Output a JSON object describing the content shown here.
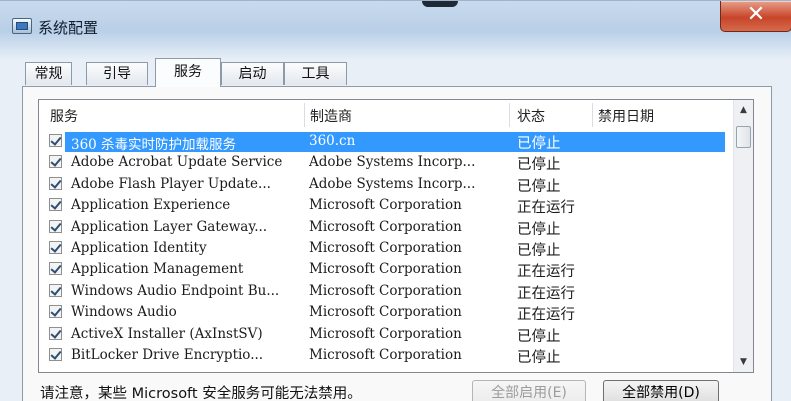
{
  "window": {
    "title": "系统配置",
    "close_label": "✕"
  },
  "tabs": [
    {
      "label": "常规"
    },
    {
      "label": "引导"
    },
    {
      "label": "服务"
    },
    {
      "label": "启动"
    },
    {
      "label": "工具"
    }
  ],
  "active_tab": "服务",
  "table": {
    "headers": {
      "service": "服务",
      "manufacturer": "制造商",
      "status": "状态",
      "disabled_date": "禁用日期"
    },
    "rows": [
      {
        "service": "360 杀毒实时防护加载服务",
        "manufacturer": "360.cn",
        "status": "已停止",
        "checked": true,
        "selected": true
      },
      {
        "service": "Adobe Acrobat Update Service",
        "manufacturer": "Adobe Systems Incorp...",
        "status": "已停止",
        "checked": true
      },
      {
        "service": "Adobe Flash Player Update...",
        "manufacturer": "Adobe Systems Incorp...",
        "status": "已停止",
        "checked": true
      },
      {
        "service": "Application Experience",
        "manufacturer": "Microsoft Corporation",
        "status": "正在运行",
        "checked": true
      },
      {
        "service": "Application Layer Gateway...",
        "manufacturer": "Microsoft Corporation",
        "status": "已停止",
        "checked": true
      },
      {
        "service": "Application Identity",
        "manufacturer": "Microsoft Corporation",
        "status": "已停止",
        "checked": true
      },
      {
        "service": "Application Management",
        "manufacturer": "Microsoft Corporation",
        "status": "正在运行",
        "checked": true
      },
      {
        "service": "Windows Audio Endpoint Bu...",
        "manufacturer": "Microsoft Corporation",
        "status": "正在运行",
        "checked": true
      },
      {
        "service": "Windows Audio",
        "manufacturer": "Microsoft Corporation",
        "status": "正在运行",
        "checked": true
      },
      {
        "service": "ActiveX Installer (AxInstSV)",
        "manufacturer": "Microsoft Corporation",
        "status": "已停止",
        "checked": true
      },
      {
        "service": "BitLocker Drive Encryptio...",
        "manufacturer": "Microsoft Corporation",
        "status": "已停止",
        "checked": true
      }
    ]
  },
  "footer": {
    "notice": "请注意，某些 Microsoft 安全服务可能无法禁用。",
    "enable_all": "全部启用(E)",
    "disable_all": "全部禁用(D)"
  },
  "colors": {
    "selection": "#3399ff",
    "close_button": "#c8452a"
  },
  "icons": {
    "title": "msconfig-icon",
    "close": "close-icon",
    "scroll_up": "scroll-up-arrow-icon",
    "scroll_down": "scroll-down-arrow-icon",
    "checkbox": "checkmark-icon"
  }
}
